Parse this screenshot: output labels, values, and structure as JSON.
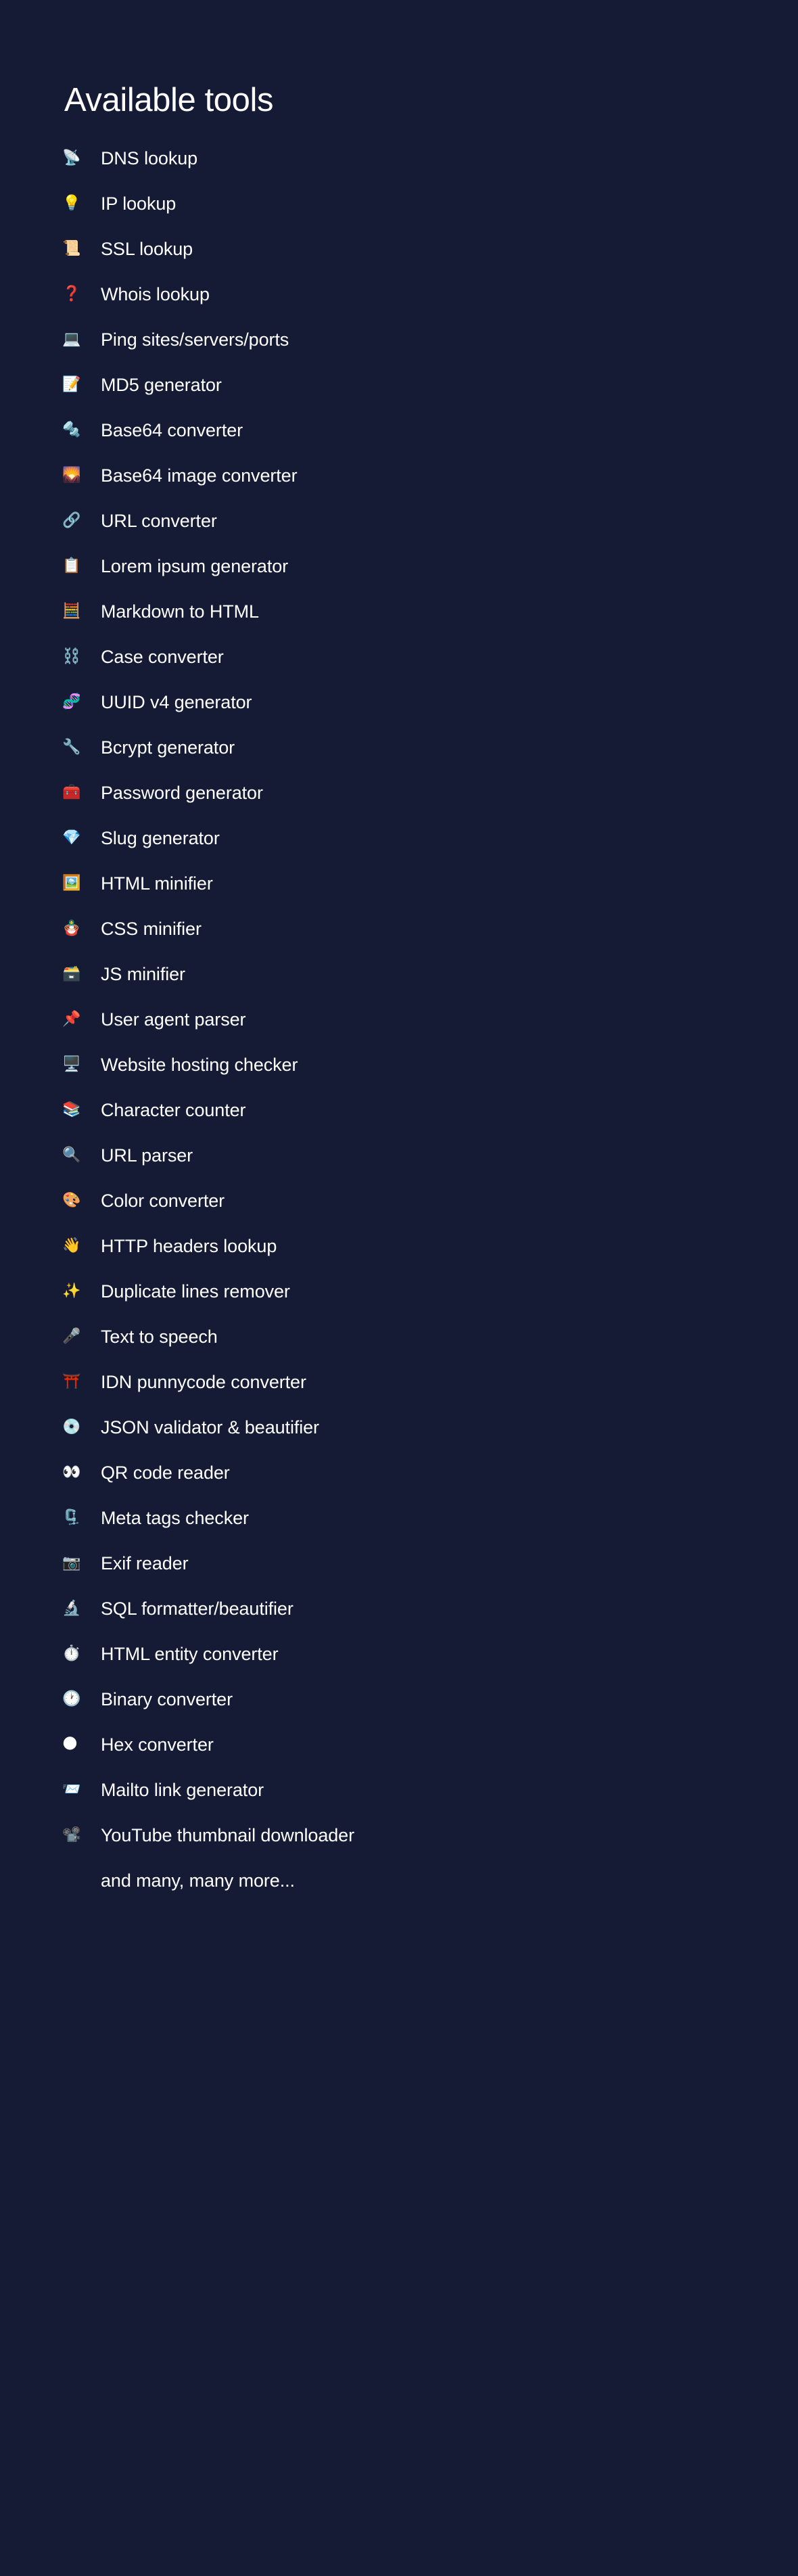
{
  "heading": "Available tools",
  "colors": {
    "background": "#161b35",
    "text": "#ffffff"
  },
  "tools": [
    {
      "icon": "📡",
      "icon_name": "satellite-antenna-icon",
      "label": "DNS lookup"
    },
    {
      "icon": "💡",
      "icon_name": "light-bulb-icon",
      "label": "IP lookup"
    },
    {
      "icon": "📜",
      "icon_name": "scroll-icon",
      "label": "SSL lookup"
    },
    {
      "icon": "❓",
      "icon_name": "red-question-mark-icon",
      "label": "Whois lookup"
    },
    {
      "icon": "💻",
      "icon_name": "laptop-icon",
      "label": "Ping sites/servers/ports"
    },
    {
      "icon": "📝",
      "icon_name": "memo-icon",
      "label": "MD5 generator"
    },
    {
      "icon": "🔩",
      "icon_name": "nut-and-bolt-icon",
      "label": "Base64 converter"
    },
    {
      "icon": "🌄",
      "icon_name": "sunrise-over-mountains-icon",
      "label": "Base64 image converter"
    },
    {
      "icon": "🔗",
      "icon_name": "link-icon",
      "label": "URL converter"
    },
    {
      "icon": "📋",
      "icon_name": "clipboard-icon",
      "label": "Lorem ipsum generator"
    },
    {
      "icon": "🧮",
      "icon_name": "abacus-icon",
      "label": "Markdown to HTML"
    },
    {
      "icon": "⛓️",
      "icon_name": "chains-icon",
      "label": "Case converter"
    },
    {
      "icon": "🧬",
      "icon_name": "dna-icon",
      "label": "UUID v4 generator"
    },
    {
      "icon": "🔧",
      "icon_name": "wrench-icon",
      "label": "Bcrypt generator"
    },
    {
      "icon": "🧰",
      "icon_name": "toolbox-icon",
      "label": "Password generator"
    },
    {
      "icon": "💎",
      "icon_name": "gem-stone-icon",
      "label": "Slug generator"
    },
    {
      "icon": "🖼️",
      "icon_name": "framed-picture-icon",
      "label": "HTML minifier"
    },
    {
      "icon": "🪆",
      "icon_name": "nesting-dolls-icon",
      "label": "CSS minifier"
    },
    {
      "icon": "🗃️",
      "icon_name": "card-file-box-icon",
      "label": "JS minifier"
    },
    {
      "icon": "📌",
      "icon_name": "pushpin-note-icon",
      "label": "User agent parser"
    },
    {
      "icon": "🖥️",
      "icon_name": "desktop-computer-icon",
      "label": "Website hosting checker"
    },
    {
      "icon": "📚",
      "icon_name": "books-icon",
      "label": "Character counter"
    },
    {
      "icon": "🔍",
      "icon_name": "magnifying-glass-icon",
      "label": "URL parser"
    },
    {
      "icon": "🎨",
      "icon_name": "artist-palette-icon",
      "label": "Color converter"
    },
    {
      "icon": "👋",
      "icon_name": "waving-hand-icon",
      "label": "HTTP headers lookup"
    },
    {
      "icon": "✨",
      "icon_name": "sparkles-icon",
      "label": "Duplicate lines remover"
    },
    {
      "icon": "🎤",
      "icon_name": "microphone-icon",
      "label": "Text to speech"
    },
    {
      "icon": "⛩️",
      "icon_name": "shinto-shrine-icon",
      "label": "IDN punnycode converter"
    },
    {
      "icon": "💿",
      "icon_name": "optical-disk-icon",
      "label": "JSON validator & beautifier"
    },
    {
      "icon": "👀",
      "icon_name": "eyes-icon",
      "label": "QR code reader"
    },
    {
      "icon": "🗜️",
      "icon_name": "clamp-icon",
      "label": "Meta tags checker"
    },
    {
      "icon": "📷",
      "icon_name": "camera-icon",
      "label": "Exif reader"
    },
    {
      "icon": "🔬",
      "icon_name": "microscope-icon",
      "label": "SQL formatter/beautifier"
    },
    {
      "icon": "⏱️",
      "icon_name": "stopwatch-icon",
      "label": "HTML entity converter"
    },
    {
      "icon": "🕐",
      "icon_name": "clock-face-icon",
      "label": "Binary converter"
    },
    {
      "icon": "🌑",
      "icon_name": "new-moon-icon",
      "label": "Hex converter"
    },
    {
      "icon": "📨",
      "icon_name": "incoming-envelope-icon",
      "label": "Mailto link generator"
    },
    {
      "icon": "📽️",
      "icon_name": "film-projector-icon",
      "label": "YouTube thumbnail downloader"
    },
    {
      "icon": "",
      "icon_name": "no-icon",
      "label": "and many, many more..."
    }
  ]
}
